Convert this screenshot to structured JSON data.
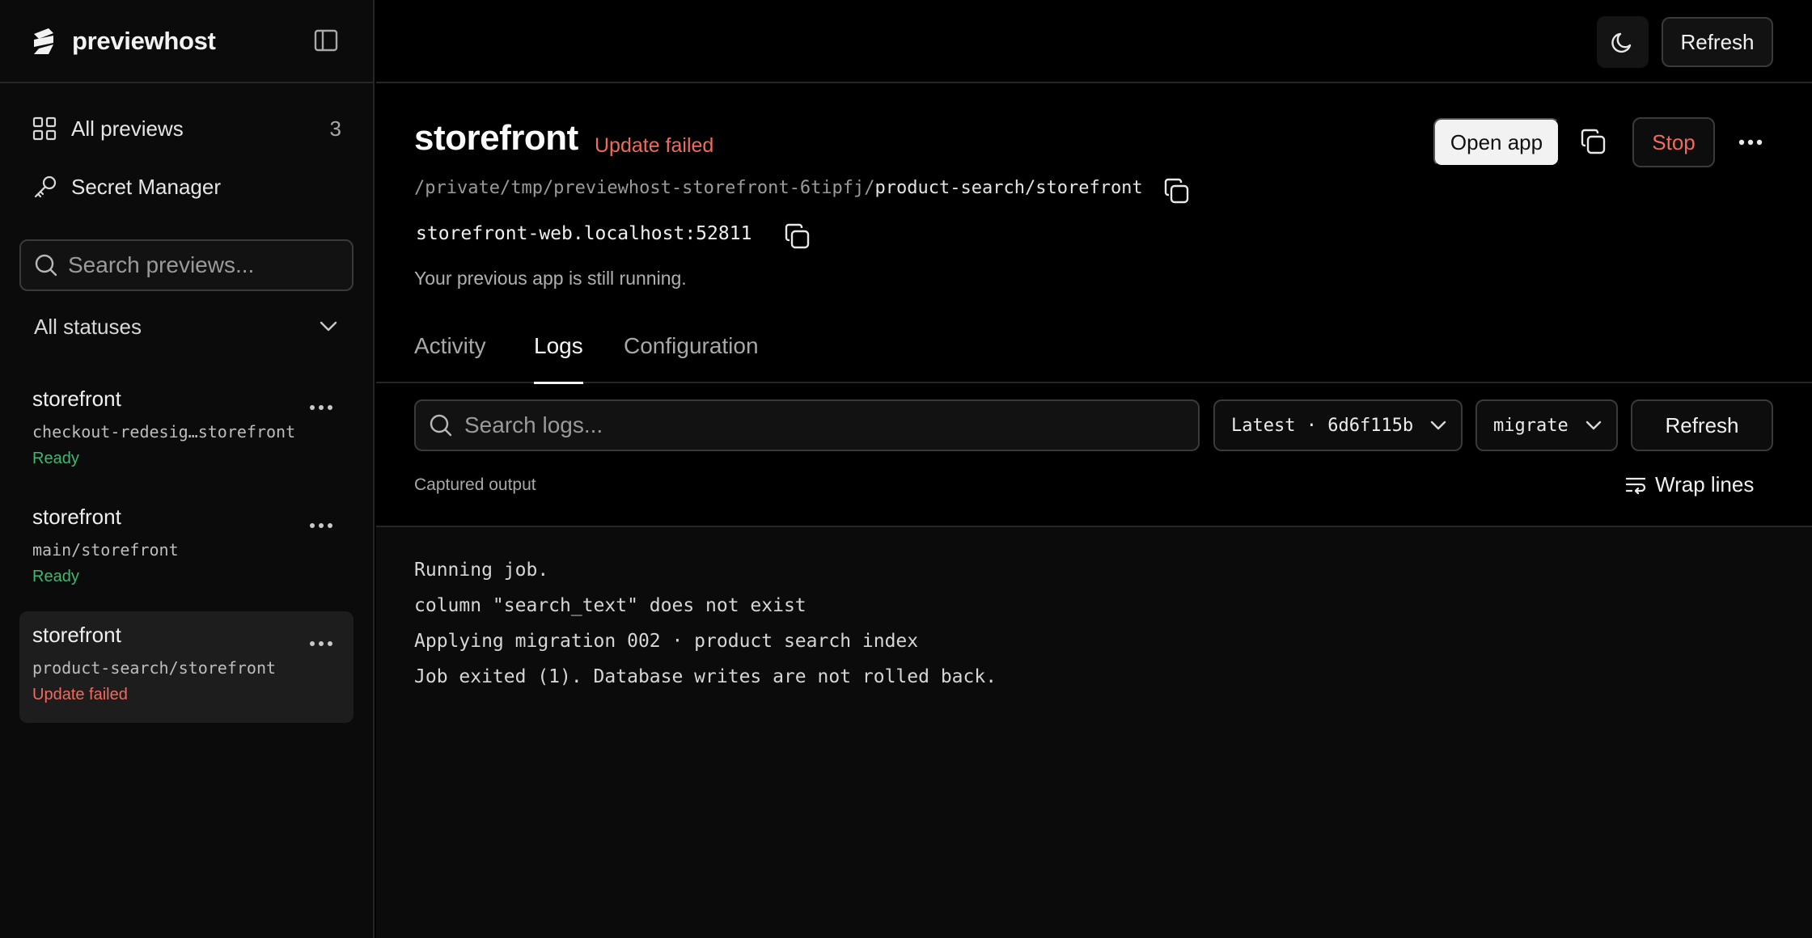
{
  "brand": {
    "name": "previewhost"
  },
  "sidebar": {
    "nav": [
      {
        "label": "All previews",
        "count": "3",
        "icon": "grid-icon"
      },
      {
        "label": "Secret Manager",
        "icon": "key-icon"
      }
    ],
    "search_placeholder": "Search previews...",
    "status_filter": "All statuses",
    "previews": [
      {
        "name": "storefront",
        "path": "checkout-redesig…storefront",
        "status": "Ready",
        "status_color": "#3fb871"
      },
      {
        "name": "storefront",
        "path": "main/storefront",
        "status": "Ready",
        "status_color": "#3fb871"
      },
      {
        "name": "storefront",
        "path": "product-search/storefront",
        "status": "Update failed",
        "status_color": "#f06a5e"
      }
    ]
  },
  "topbar": {
    "refresh_label": "Refresh",
    "theme_icon": "moon-icon"
  },
  "preview": {
    "title": "storefront",
    "status": "Update failed",
    "path_prefix": "/private/tmp/previewhost-storefront-6tipfj/",
    "path_suffix": "product-search/storefront",
    "host": "storefront-web.localhost:52811",
    "note": "Your previous app is still running.",
    "open_app_label": "Open app",
    "stop_label": "Stop"
  },
  "tabs": [
    {
      "label": "Activity"
    },
    {
      "label": "Logs",
      "active": true
    },
    {
      "label": "Configuration"
    }
  ],
  "logs": {
    "search_placeholder": "Search logs...",
    "build_select": "Latest · 6d6f115b",
    "job_select": "migrate",
    "refresh_label": "Refresh",
    "captured_label": "Captured output",
    "wrap_label": "Wrap lines",
    "lines": [
      "Running job.",
      "column \"search_text\" does not exist",
      "Applying migration 002 · product search index",
      "Job exited (1). Database writes are not rolled back."
    ]
  },
  "colors": {
    "accent_error": "#f06a5e",
    "accent_ok": "#3fb871",
    "background": "#000000"
  }
}
